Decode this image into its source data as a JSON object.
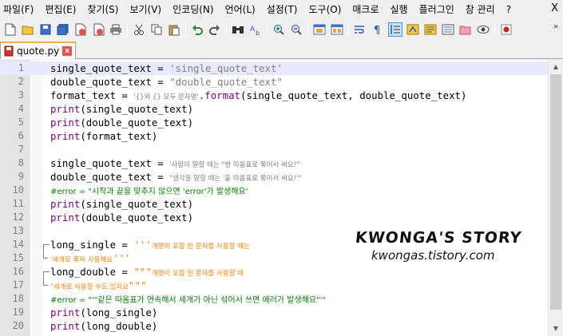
{
  "menu": [
    "파일(F)",
    "편집(E)",
    "찾기(S)",
    "보기(V)",
    "인코딩(N)",
    "언어(L)",
    "설정(T)",
    "도구(O)",
    "매크로",
    "실행",
    "플러그인",
    "창 관리",
    "?"
  ],
  "menu_close": "X",
  "toolbar_more": "»",
  "tab": {
    "label": "quote.py",
    "close": "x"
  },
  "lines": [
    {
      "n": "1"
    },
    {
      "n": "2"
    },
    {
      "n": "3"
    },
    {
      "n": "4"
    },
    {
      "n": "5"
    },
    {
      "n": "6"
    },
    {
      "n": "7"
    },
    {
      "n": "8"
    },
    {
      "n": "9"
    },
    {
      "n": "10"
    },
    {
      "n": "11"
    },
    {
      "n": "12"
    },
    {
      "n": "13"
    },
    {
      "n": "14"
    },
    {
      "n": "15"
    },
    {
      "n": "16"
    },
    {
      "n": "17"
    },
    {
      "n": "18"
    },
    {
      "n": "19"
    },
    {
      "n": "20"
    }
  ],
  "code": {
    "l1": [
      "single_quote_text = ",
      "'single_quote_text'"
    ],
    "l2": [
      "double_quote_text = ",
      "\"double_quote_text\""
    ],
    "l3": [
      "format_text = ",
      "'{}와 {} 모두 문자열'",
      ".format",
      "(single_quote_text, double_quote_text)"
    ],
    "l4": [
      "print",
      "(single_quote_text)"
    ],
    "l5": [
      "print",
      "(double_quote_text)"
    ],
    "l6": [
      "print",
      "(format_text)"
    ],
    "l8": [
      "single_quote_text = ",
      "'사람이 말할 때는 \"쌍 따옴표로 묶어서 써요!\"'"
    ],
    "l9": [
      "double_quote_text = ",
      "\"생각을 말할 때는 '홑 따옴표로 묶어서 써요!'\""
    ],
    "l10": "#error = \"시작과 끝을 맞추지 않으면 'error'가 발생해요'",
    "l11": [
      "print",
      "(single_quote_text)"
    ],
    "l12": [
      "print",
      "(double_quote_text)"
    ],
    "l14": [
      "long_single = ",
      "'''",
      "개행이 포함 된 문자를 사용할 때는"
    ],
    "l15": [
      "'세개로 묶어 사용해요",
      "'''"
    ],
    "l16": [
      "long_double = ",
      "\"\"\"",
      "개행이 포함 된 문자를 사용할 때"
    ],
    "l17": [
      "\"세개로 사용할 수도 있지요",
      "\"\"\""
    ],
    "l18": "#error = \"'\"같은 따옴표가 연속해서 세개가 아닌 섞어서 쓰면 에러가 발생해요\"'\"",
    "l19": [
      "print",
      "(long_single)"
    ],
    "l20": [
      "print",
      "(long_double)"
    ]
  },
  "watermark": {
    "title": "KWONGA'S STORY",
    "url": "kwongas.tistory.com"
  },
  "colors": {
    "keyword": "#800080",
    "string": "#808080",
    "comment": "#008000",
    "triple_quote": "#ff8000",
    "gutter": "#e4e4e4",
    "tab_accent": "#f7b335"
  }
}
